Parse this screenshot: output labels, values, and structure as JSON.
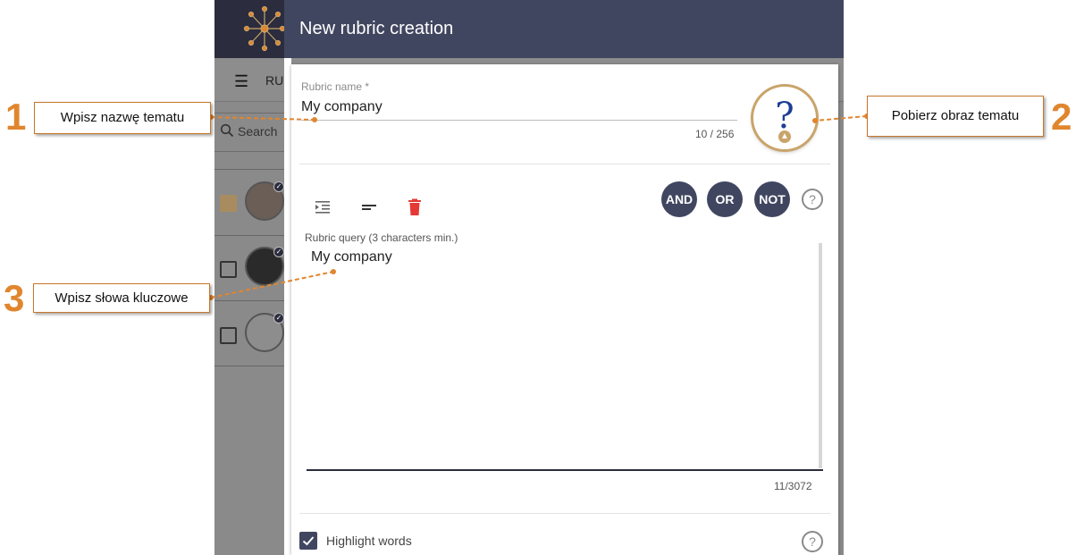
{
  "dialog": {
    "title": "New rubric creation",
    "rubric_name_label": "Rubric name *",
    "rubric_name_value": "My company",
    "rubric_name_counter": "10 / 256",
    "rubric_query_label": "Rubric query (3 characters min.)",
    "rubric_query_value": "My company",
    "rubric_query_counter": "11/3072",
    "image_picker_glyph": "?",
    "operators": [
      "AND",
      "OR",
      "NOT"
    ],
    "highlight_label": "Highlight words",
    "highlight_checked": true,
    "help_glyph": "?",
    "delete_color": "#e53935"
  },
  "background_app": {
    "tab_label": "RUB",
    "search_placeholder": "Search",
    "accent": "#2b2c3d"
  },
  "annotations": [
    {
      "number": "1",
      "text": "Wpisz nazwę tematu"
    },
    {
      "number": "2",
      "text": "Pobierz obraz tematu"
    },
    {
      "number": "3",
      "text": "Wpisz słowa kluczowe"
    }
  ],
  "icons": {
    "indent": "indent-icon",
    "align": "short-text-icon",
    "delete": "trash-icon",
    "list": "list-icon",
    "search": "search-icon",
    "upload": "upload-icon",
    "check": "checkmark-icon"
  },
  "colors": {
    "header": "#414660",
    "annotation": "#e0862e"
  }
}
